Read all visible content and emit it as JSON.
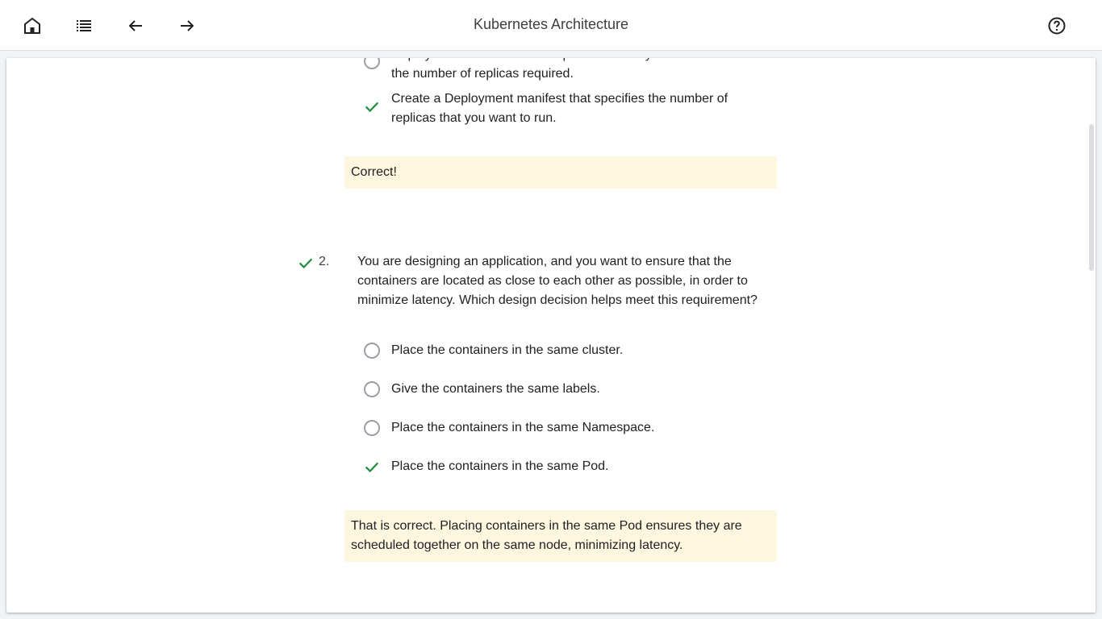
{
  "header": {
    "title": "Kubernetes Architecture",
    "icons": {
      "home": "home-icon",
      "toc": "list-icon",
      "back": "arrow-back-icon",
      "forward": "arrow-forward-icon",
      "help": "help-icon"
    }
  },
  "question1": {
    "options": [
      {
        "text": "Deploy the Pod manifest multiple times until you have achieved the number of replicas required.",
        "state": "unselected"
      },
      {
        "text": "Create a Deployment manifest that specifies the number of replicas that you want to run.",
        "state": "correct"
      }
    ],
    "feedback": "Correct!"
  },
  "question2": {
    "number": "2.",
    "status": "correct",
    "text": "You are designing an application, and you want to ensure that the containers are located as close to each other as possible, in order to minimize latency. Which design decision helps meet this requirement?",
    "options": [
      {
        "text": "Place the containers in the same cluster.",
        "state": "unselected"
      },
      {
        "text": "Give the containers the same labels.",
        "state": "unselected"
      },
      {
        "text": "Place the containers in the same Namespace.",
        "state": "unselected"
      },
      {
        "text": "Place the containers in the same Pod.",
        "state": "correct"
      }
    ],
    "feedback": "That is correct. Placing containers in the same Pod ensures they are scheduled together on the same node, minimizing latency."
  },
  "colors": {
    "check": "#1e8e3e",
    "feedback_bg": "#fef7e0",
    "radio_border": "#9aa0a6"
  }
}
